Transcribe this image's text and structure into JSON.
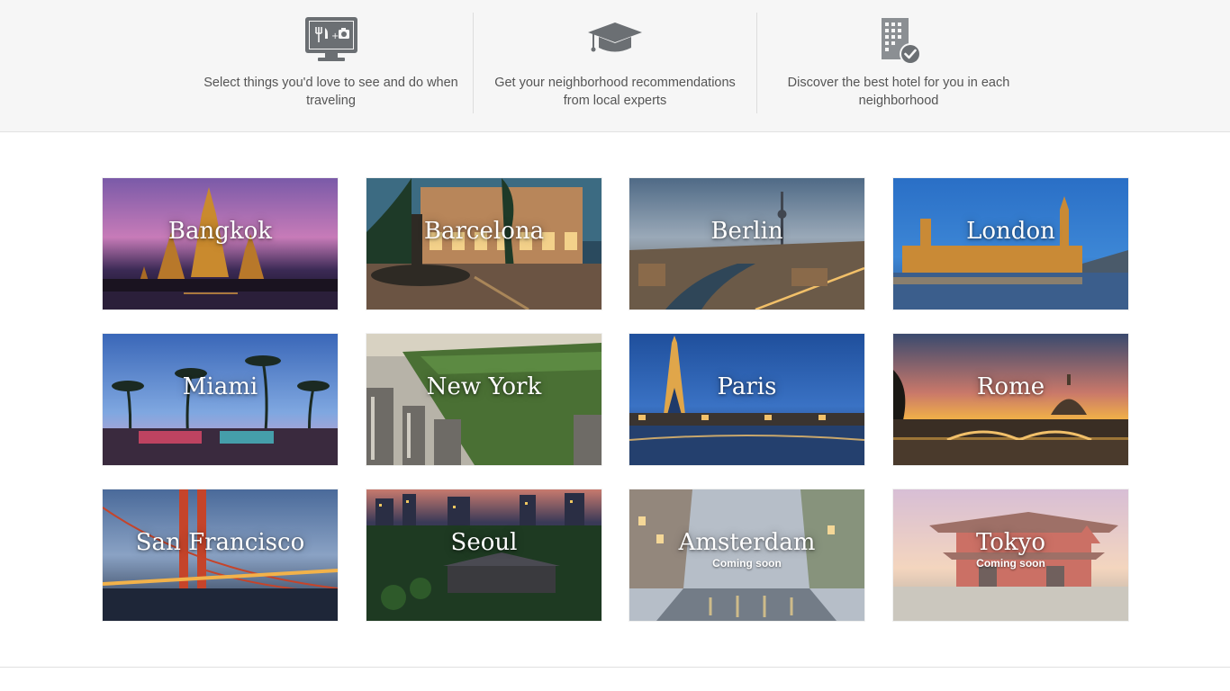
{
  "features": [
    {
      "icon": "monitor-food-camera-icon",
      "text": "Select things you'd love to see and do when traveling"
    },
    {
      "icon": "graduation-cap-icon",
      "text": "Get your neighborhood recommendations from local experts"
    },
    {
      "icon": "hotel-check-icon",
      "text": "Discover the best hotel for you in each neighborhood"
    }
  ],
  "cities": [
    {
      "name": "Bangkok",
      "status": ""
    },
    {
      "name": "Barcelona",
      "status": ""
    },
    {
      "name": "Berlin",
      "status": ""
    },
    {
      "name": "London",
      "status": ""
    },
    {
      "name": "Miami",
      "status": ""
    },
    {
      "name": "New York",
      "status": ""
    },
    {
      "name": "Paris",
      "status": ""
    },
    {
      "name": "Rome",
      "status": ""
    },
    {
      "name": "San Francisco",
      "status": ""
    },
    {
      "name": "Seoul",
      "status": ""
    },
    {
      "name": "Amsterdam",
      "status": "Coming soon"
    },
    {
      "name": "Tokyo",
      "status": "Coming soon"
    }
  ],
  "colors": {
    "feature_background": "#f6f6f6",
    "icon_gray": "#6b6f73",
    "feature_text": "#555555"
  }
}
